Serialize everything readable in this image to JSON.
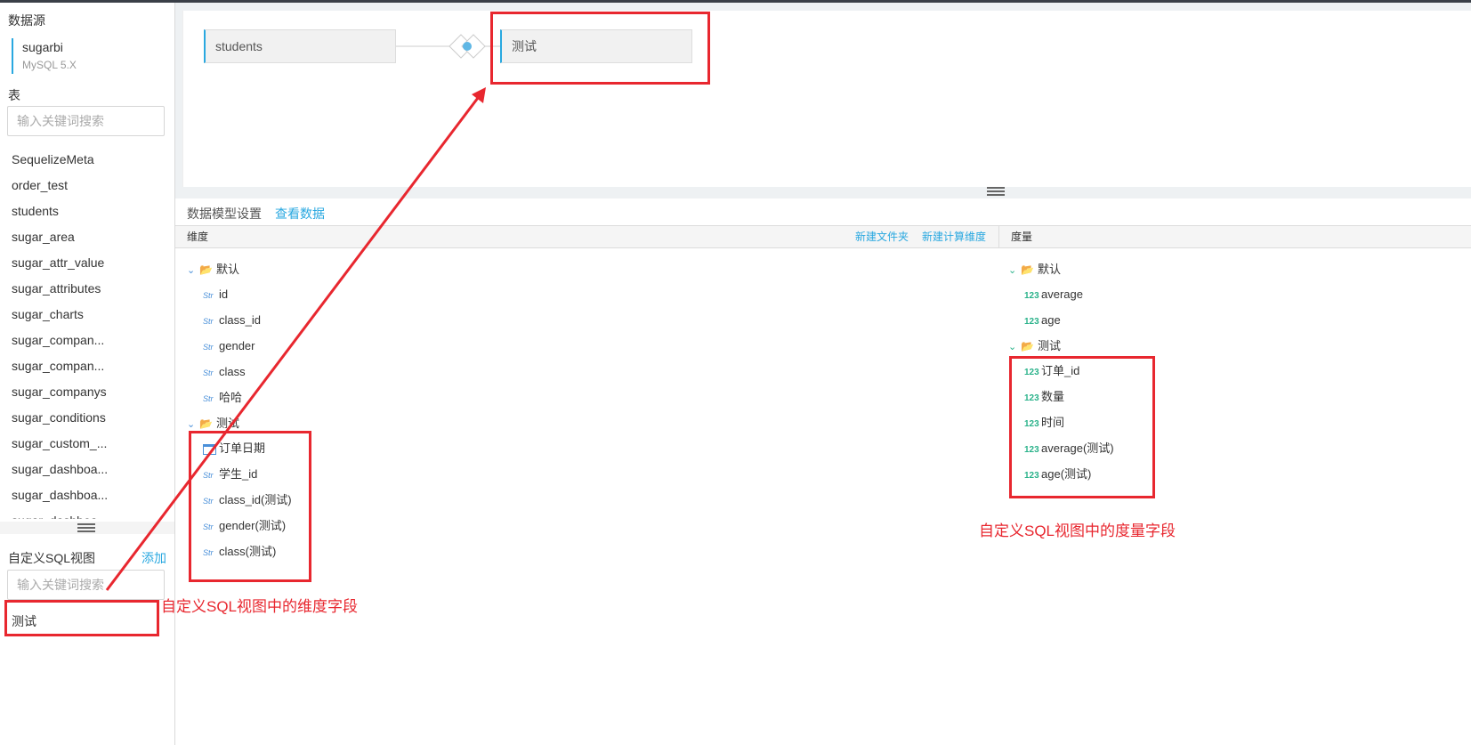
{
  "sidebar": {
    "datasource_title": "数据源",
    "datasource_name": "sugarbi",
    "datasource_version": "MySQL 5.X",
    "tables_title": "表",
    "tables_search_placeholder": "输入关键词搜索",
    "tables": [
      "SequelizeMeta",
      "order_test",
      "students",
      "sugar_area",
      "sugar_attr_value",
      "sugar_attributes",
      "sugar_charts",
      "sugar_compan...",
      "sugar_compan...",
      "sugar_companys",
      "sugar_conditions",
      "sugar_custom_...",
      "sugar_dashboa...",
      "sugar_dashboa...",
      "sugar_dashboa..."
    ],
    "custom_sql_title": "自定义SQL视图",
    "custom_sql_add": "添加",
    "custom_sql_search_placeholder": "输入关键词搜索",
    "custom_sql_items": [
      "测试"
    ]
  },
  "canvas": {
    "nodes": [
      "students",
      "测试"
    ]
  },
  "tabs": {
    "model_settings": "数据模型设置",
    "view_data": "查看数据"
  },
  "dimensions": {
    "header": "维度",
    "new_folder": "新建文件夹",
    "new_calc_dim": "新建计算维度",
    "folders": [
      {
        "name": "默认",
        "fields": [
          {
            "type": "Str",
            "name": "id"
          },
          {
            "type": "Str",
            "name": "class_id"
          },
          {
            "type": "Str",
            "name": "gender"
          },
          {
            "type": "Str",
            "name": "class"
          },
          {
            "type": "Str",
            "name": "哈哈"
          }
        ]
      },
      {
        "name": "测试",
        "fields": [
          {
            "type": "date",
            "name": "订单日期"
          },
          {
            "type": "Str",
            "name": "学生_id"
          },
          {
            "type": "Str",
            "name": "class_id(测试)"
          },
          {
            "type": "Str",
            "name": "gender(测试)"
          },
          {
            "type": "Str",
            "name": "class(测试)"
          }
        ]
      }
    ]
  },
  "measures": {
    "header": "度量",
    "folders": [
      {
        "name": "默认",
        "fields": [
          {
            "type": "123",
            "name": "average"
          },
          {
            "type": "123",
            "name": "age"
          }
        ]
      },
      {
        "name": "测试",
        "fields": [
          {
            "type": "123",
            "name": "订单_id"
          },
          {
            "type": "123",
            "name": "数量"
          },
          {
            "type": "123",
            "name": "时间"
          },
          {
            "type": "123",
            "name": "average(测试)"
          },
          {
            "type": "123",
            "name": "age(测试)"
          }
        ]
      }
    ]
  },
  "annotations": {
    "dimension_note": "自定义SQL视图中的维度字段",
    "measure_note": "自定义SQL视图中的度量字段",
    "color": "#e8272f"
  },
  "colors": {
    "accent": "#29a8e0",
    "annotation": "#e8272f"
  }
}
